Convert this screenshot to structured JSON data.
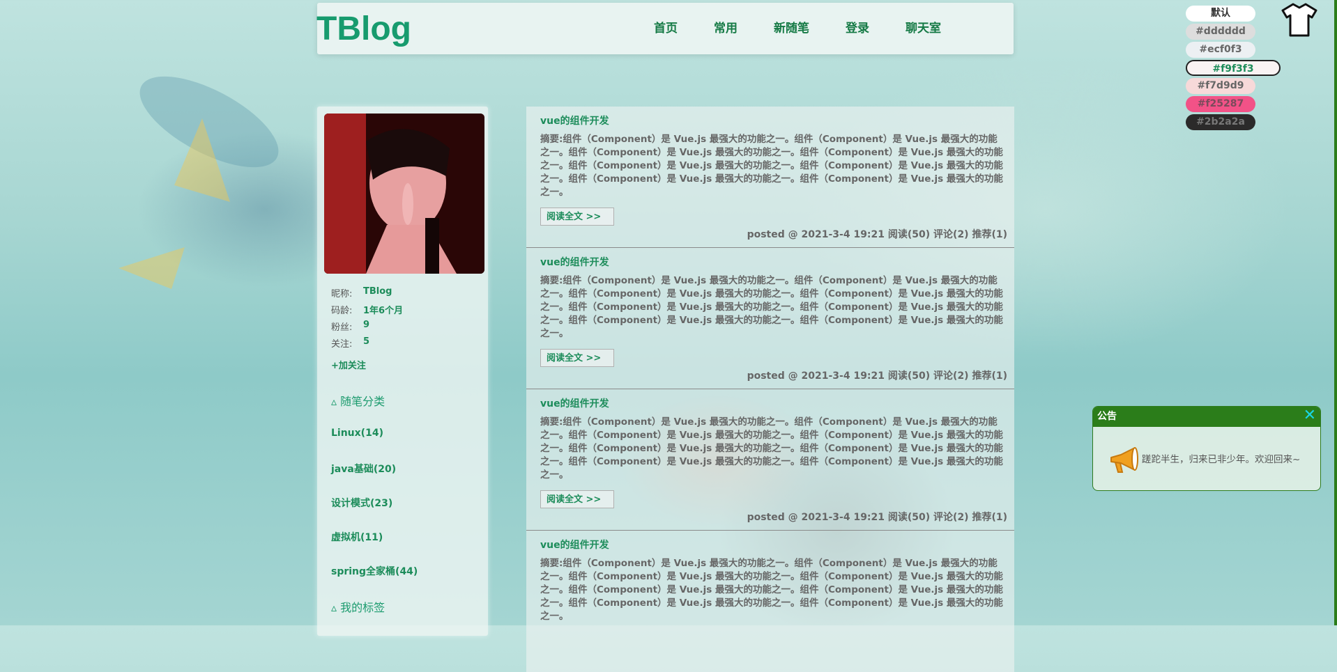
{
  "header": {
    "logo": "TBlog",
    "nav": [
      "首页",
      "常用",
      "新随笔",
      "登录",
      "聊天室"
    ]
  },
  "themes": [
    {
      "label": "默认",
      "bg": "#ffffff",
      "color": "#333333"
    },
    {
      "label": "#dddddd",
      "bg": "#dddddd",
      "color": "#666666"
    },
    {
      "label": "#ecf0f3",
      "bg": "#ecf0f3",
      "color": "#666666"
    },
    {
      "label": "#f9f3f3",
      "bg": "#f9f3f3",
      "color": "#1c8c5a"
    },
    {
      "label": "#f7d9d9",
      "bg": "#f7d9d9",
      "color": "#666666"
    },
    {
      "label": "#f25287",
      "bg": "#f25287",
      "color": "#7a4b5b"
    },
    {
      "label": "#2b2a2a",
      "bg": "#2b2a2a",
      "color": "#777777"
    }
  ],
  "profile": {
    "nickname_label": "昵称:",
    "nickname": "TBlog",
    "age_label": "码龄:",
    "age": "1年6个月",
    "fans_label": "粉丝:",
    "fans": "9",
    "follow_label": "关注:",
    "follow": "5",
    "follow_button": "+加关注"
  },
  "sidebar": {
    "category_title": "▵ 随笔分类",
    "categories": [
      "Linux(14)",
      "java基础(20)",
      "设计模式(23)",
      "虚拟机(11)",
      "spring全家桶(44)"
    ],
    "tags_title": "▵ 我的标签"
  },
  "posts": [
    {
      "title": "vue的组件开发",
      "summary": "摘要:组件（Component）是 Vue.js 最强大的功能之一。组件（Component）是 Vue.js 最强大的功能之一。组件（Component）是 Vue.js 最强大的功能之一。组件（Component）是 Vue.js 最强大的功能之一。组件（Component）是 Vue.js 最强大的功能之一。组件（Component）是 Vue.js 最强大的功能之一。组件（Component）是 Vue.js 最强大的功能之一。组件（Component）是 Vue.js 最强大的功能之一。",
      "read_more": "阅读全文 >>",
      "meta": "posted @ 2021-3-4 19:21 阅读(50) 评论(2) 推荐(1)"
    },
    {
      "title": "vue的组件开发",
      "summary": "摘要:组件（Component）是 Vue.js 最强大的功能之一。组件（Component）是 Vue.js 最强大的功能之一。组件（Component）是 Vue.js 最强大的功能之一。组件（Component）是 Vue.js 最强大的功能之一。组件（Component）是 Vue.js 最强大的功能之一。组件（Component）是 Vue.js 最强大的功能之一。组件（Component）是 Vue.js 最强大的功能之一。组件（Component）是 Vue.js 最强大的功能之一。",
      "read_more": "阅读全文 >>",
      "meta": "posted @ 2021-3-4 19:21 阅读(50) 评论(2) 推荐(1)"
    },
    {
      "title": "vue的组件开发",
      "summary": "摘要:组件（Component）是 Vue.js 最强大的功能之一。组件（Component）是 Vue.js 最强大的功能之一。组件（Component）是 Vue.js 最强大的功能之一。组件（Component）是 Vue.js 最强大的功能之一。组件（Component）是 Vue.js 最强大的功能之一。组件（Component）是 Vue.js 最强大的功能之一。组件（Component）是 Vue.js 最强大的功能之一。组件（Component）是 Vue.js 最强大的功能之一。",
      "read_more": "阅读全文 >>",
      "meta": "posted @ 2021-3-4 19:21 阅读(50) 评论(2) 推荐(1)"
    },
    {
      "title": "vue的组件开发",
      "summary": "摘要:组件（Component）是 Vue.js 最强大的功能之一。组件（Component）是 Vue.js 最强大的功能之一。组件（Component）是 Vue.js 最强大的功能之一。组件（Component）是 Vue.js 最强大的功能之一。组件（Component）是 Vue.js 最强大的功能之一。组件（Component）是 Vue.js 最强大的功能之一。组件（Component）是 Vue.js 最强大的功能之一。组件（Component）是 Vue.js 最强大的功能之一。",
      "read_more": "",
      "meta": ""
    }
  ],
  "notice": {
    "title": "公告",
    "close": "✕",
    "icon": "megaphone-icon",
    "text": "蹉跎半生，归来已非少年。欢迎回来~"
  },
  "colors": {
    "brand": "#179b6e",
    "link": "#1c8c5a",
    "notice_header": "#2b7d1a"
  }
}
